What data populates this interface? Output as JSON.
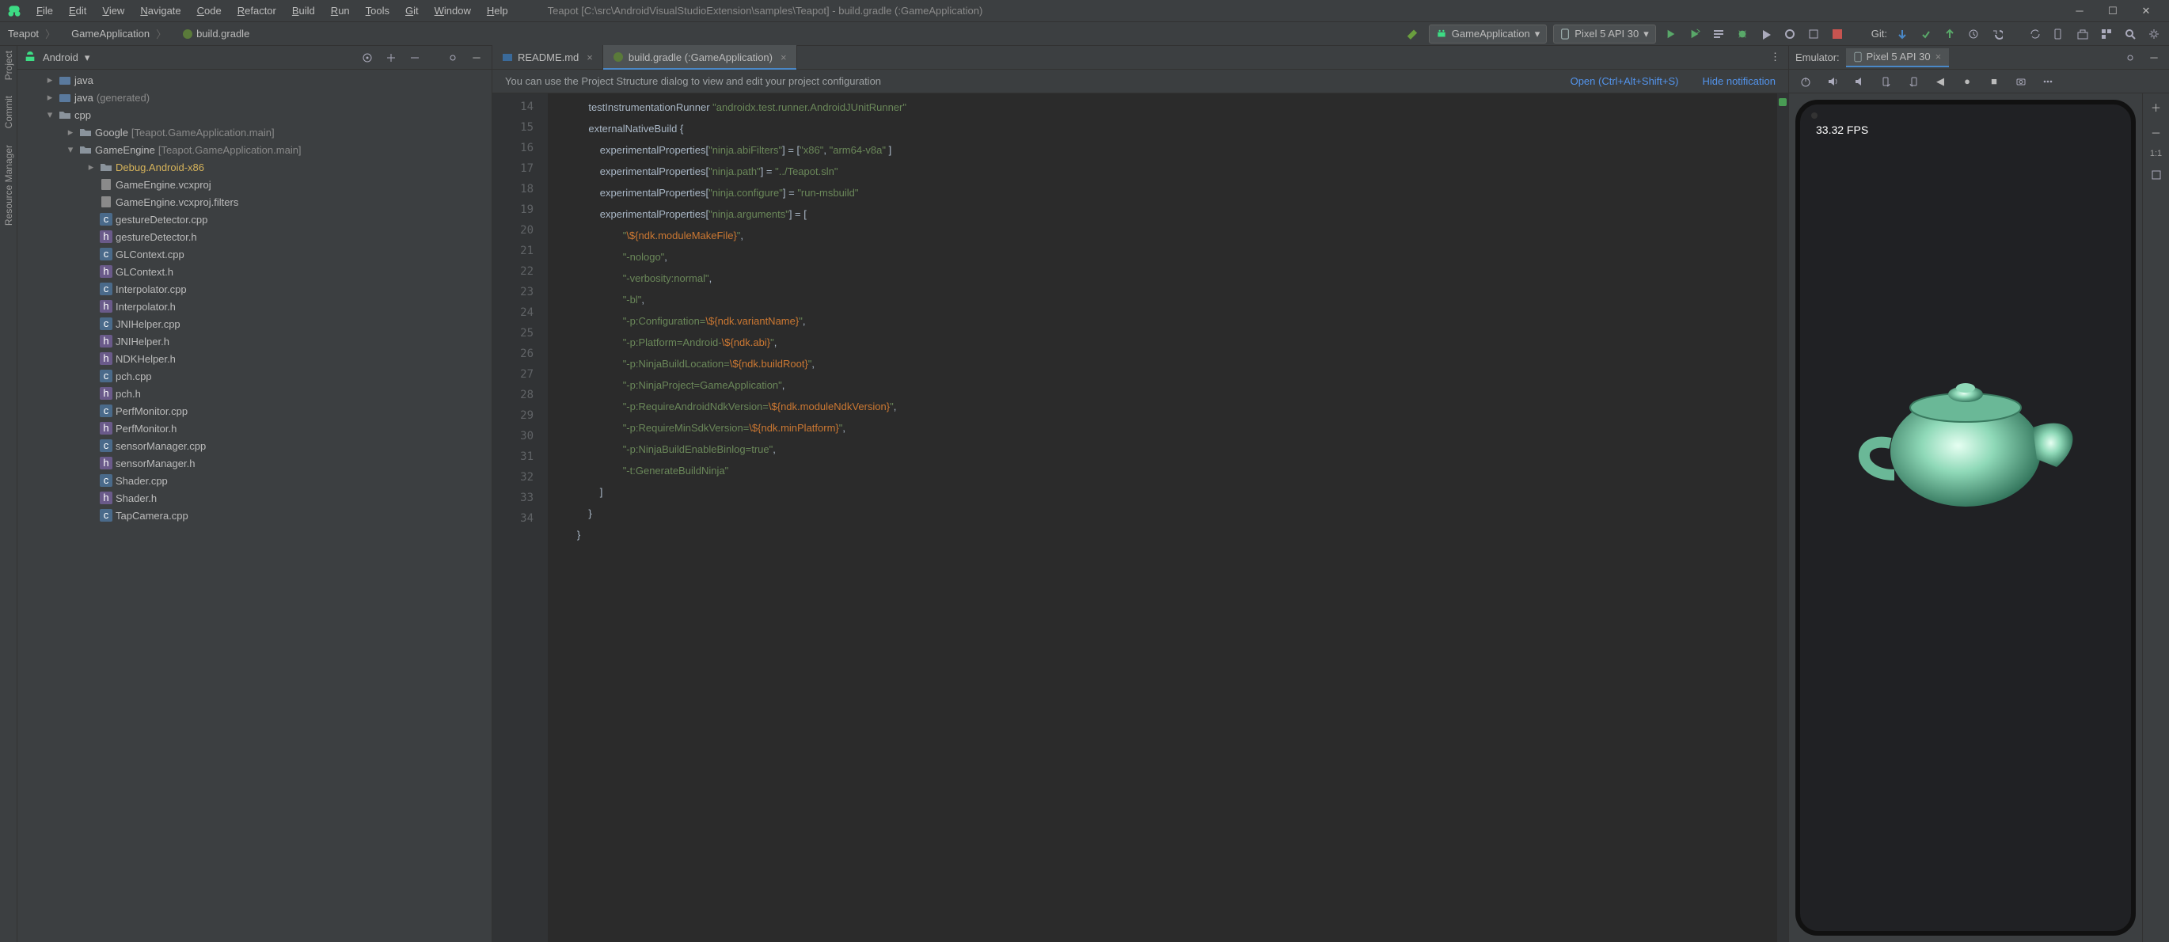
{
  "window": {
    "title": "Teapot [C:\\src\\AndroidVisualStudioExtension\\samples\\Teapot] - build.gradle (:GameApplication)"
  },
  "menu": [
    "File",
    "Edit",
    "View",
    "Navigate",
    "Code",
    "Refactor",
    "Build",
    "Run",
    "Tools",
    "Git",
    "Window",
    "Help"
  ],
  "breadcrumb": [
    "Teapot",
    "GameApplication",
    "build.gradle"
  ],
  "runbar": {
    "config": "GameApplication",
    "device": "Pixel 5 API 30",
    "git_label": "Git:"
  },
  "projpane": {
    "view": "Android",
    "tree": [
      {
        "d": 1,
        "arrow": ">",
        "icon": "pkg",
        "label": "java"
      },
      {
        "d": 1,
        "arrow": ">",
        "icon": "pkg",
        "label": "java",
        "suffix": "(generated)"
      },
      {
        "d": 1,
        "arrow": "v",
        "icon": "folder",
        "label": "cpp"
      },
      {
        "d": 2,
        "arrow": ">",
        "icon": "folder",
        "label": "Google",
        "suffix": "[Teapot.GameApplication.main]"
      },
      {
        "d": 2,
        "arrow": "v",
        "icon": "folder",
        "label": "GameEngine",
        "suffix": "[Teapot.GameApplication.main]"
      },
      {
        "d": 3,
        "arrow": ">",
        "icon": "folder",
        "label": "Debug.Android-x86",
        "yellow": true
      },
      {
        "d": 3,
        "arrow": "",
        "icon": "file",
        "label": "GameEngine.vcxproj"
      },
      {
        "d": 3,
        "arrow": "",
        "icon": "file",
        "label": "GameEngine.vcxproj.filters"
      },
      {
        "d": 3,
        "arrow": "",
        "icon": "cpp",
        "label": "gestureDetector.cpp"
      },
      {
        "d": 3,
        "arrow": "",
        "icon": "h",
        "label": "gestureDetector.h"
      },
      {
        "d": 3,
        "arrow": "",
        "icon": "cpp",
        "label": "GLContext.cpp"
      },
      {
        "d": 3,
        "arrow": "",
        "icon": "h",
        "label": "GLContext.h"
      },
      {
        "d": 3,
        "arrow": "",
        "icon": "cpp",
        "label": "Interpolator.cpp"
      },
      {
        "d": 3,
        "arrow": "",
        "icon": "h",
        "label": "Interpolator.h"
      },
      {
        "d": 3,
        "arrow": "",
        "icon": "cpp",
        "label": "JNIHelper.cpp"
      },
      {
        "d": 3,
        "arrow": "",
        "icon": "h",
        "label": "JNIHelper.h"
      },
      {
        "d": 3,
        "arrow": "",
        "icon": "h",
        "label": "NDKHelper.h"
      },
      {
        "d": 3,
        "arrow": "",
        "icon": "cpp",
        "label": "pch.cpp"
      },
      {
        "d": 3,
        "arrow": "",
        "icon": "h",
        "label": "pch.h"
      },
      {
        "d": 3,
        "arrow": "",
        "icon": "cpp",
        "label": "PerfMonitor.cpp"
      },
      {
        "d": 3,
        "arrow": "",
        "icon": "h",
        "label": "PerfMonitor.h"
      },
      {
        "d": 3,
        "arrow": "",
        "icon": "cpp",
        "label": "sensorManager.cpp"
      },
      {
        "d": 3,
        "arrow": "",
        "icon": "h",
        "label": "sensorManager.h"
      },
      {
        "d": 3,
        "arrow": "",
        "icon": "cpp",
        "label": "Shader.cpp"
      },
      {
        "d": 3,
        "arrow": "",
        "icon": "h",
        "label": "Shader.h"
      },
      {
        "d": 3,
        "arrow": "",
        "icon": "cpp",
        "label": "TapCamera.cpp"
      }
    ]
  },
  "tabs": [
    {
      "label": "README.md",
      "active": false,
      "icon": "md"
    },
    {
      "label": "build.gradle (:GameApplication)",
      "active": true,
      "icon": "gradle"
    }
  ],
  "notification": {
    "msg": "You can use the Project Structure dialog to view and edit your project configuration",
    "open": "Open (Ctrl+Alt+Shift+S)",
    "hide": "Hide notification"
  },
  "code": {
    "first_line": 14,
    "lines": [
      [
        [
          "id",
          "            testInstrumentationRunner "
        ],
        [
          "str",
          "\"androidx.test.runner.AndroidJUnitRunner\""
        ]
      ],
      [
        [
          "id",
          "            externalNativeBuild {"
        ]
      ],
      [
        [
          "id",
          "                experimentalProperties["
        ],
        [
          "str",
          "\"ninja.abiFilters\""
        ],
        [
          "id",
          "] = ["
        ],
        [
          "str",
          "\"x86\""
        ],
        [
          "id",
          ", "
        ],
        [
          "str",
          "\"arm64-v8a\""
        ],
        [
          "id",
          " ]"
        ]
      ],
      [
        [
          "id",
          "                experimentalProperties["
        ],
        [
          "str",
          "\"ninja.path\""
        ],
        [
          "id",
          "] = "
        ],
        [
          "str",
          "\"../Teapot.sln\""
        ]
      ],
      [
        [
          "id",
          "                experimentalProperties["
        ],
        [
          "str",
          "\"ninja.configure\""
        ],
        [
          "id",
          "] = "
        ],
        [
          "str",
          "\"run-msbuild\""
        ]
      ],
      [
        [
          "id",
          "                experimentalProperties["
        ],
        [
          "str",
          "\"ninja.arguments\""
        ],
        [
          "id",
          "] = ["
        ]
      ],
      [
        [
          "id",
          "                        "
        ],
        [
          "str",
          "\"\\${ndk.moduleMakeFile}\""
        ],
        [
          "id",
          ","
        ]
      ],
      [
        [
          "id",
          "                        "
        ],
        [
          "str",
          "\"-nologo\""
        ],
        [
          "id",
          ","
        ]
      ],
      [
        [
          "id",
          "                        "
        ],
        [
          "str",
          "\"-verbosity:normal\""
        ],
        [
          "id",
          ","
        ]
      ],
      [
        [
          "id",
          "                        "
        ],
        [
          "str",
          "\"-bl\""
        ],
        [
          "id",
          ","
        ]
      ],
      [
        [
          "id",
          "                        "
        ],
        [
          "str",
          "\"-p:Configuration=\\${ndk.variantName}\""
        ],
        [
          "id",
          ","
        ]
      ],
      [
        [
          "id",
          "                        "
        ],
        [
          "str",
          "\"-p:Platform=Android-\\${ndk.abi}\""
        ],
        [
          "id",
          ","
        ]
      ],
      [
        [
          "id",
          "                        "
        ],
        [
          "str",
          "\"-p:NinjaBuildLocation=\\${ndk.buildRoot}\""
        ],
        [
          "id",
          ","
        ]
      ],
      [
        [
          "id",
          "                        "
        ],
        [
          "str",
          "\"-p:NinjaProject=GameApplication\""
        ],
        [
          "id",
          ","
        ]
      ],
      [
        [
          "id",
          "                        "
        ],
        [
          "str",
          "\"-p:RequireAndroidNdkVersion=\\${ndk.moduleNdkVersion}\""
        ],
        [
          "id",
          ","
        ]
      ],
      [
        [
          "id",
          "                        "
        ],
        [
          "str",
          "\"-p:RequireMinSdkVersion=\\${ndk.minPlatform}\""
        ],
        [
          "id",
          ","
        ]
      ],
      [
        [
          "id",
          "                        "
        ],
        [
          "str",
          "\"-p:NinjaBuildEnableBinlog=true\""
        ],
        [
          "id",
          ","
        ]
      ],
      [
        [
          "id",
          "                        "
        ],
        [
          "str",
          "\"-t:GenerateBuildNinja\""
        ]
      ],
      [
        [
          "id",
          "                ]"
        ]
      ],
      [
        [
          "id",
          "            }"
        ]
      ],
      [
        [
          "id",
          "        }"
        ]
      ]
    ]
  },
  "emulator": {
    "header": "Emulator:",
    "tab": "Pixel 5 API 30",
    "fps": "33.32 FPS"
  },
  "leftstrip": [
    "Project",
    "Commit",
    "Resource Manager"
  ],
  "emulside": {
    "zoom_reset": "1:1"
  },
  "icons": {
    "android": "android-icon",
    "gradle": "gradle-icon",
    "md": "markdown-icon",
    "play": "play-icon",
    "stop": "stop-icon",
    "debug": "bug-icon",
    "sync": "sync-icon",
    "search": "search-icon",
    "settings": "gear-icon"
  }
}
